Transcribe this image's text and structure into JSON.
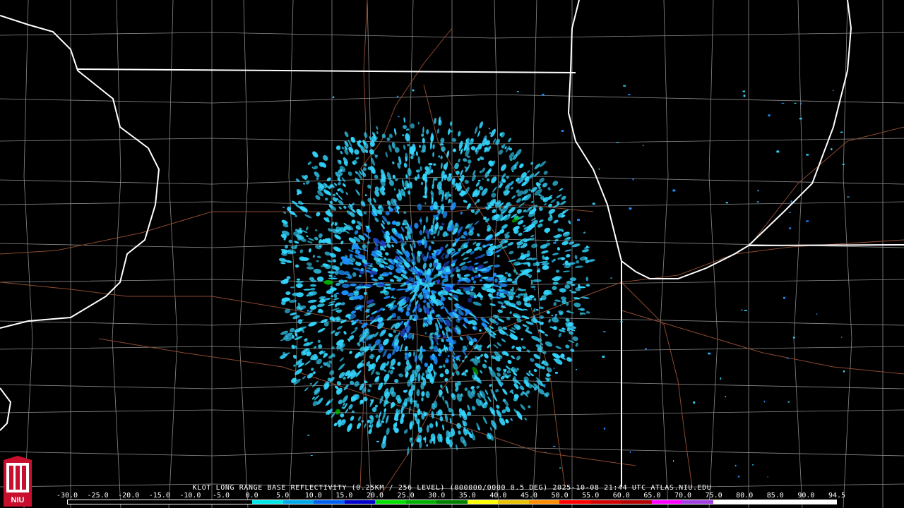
{
  "caption": "KLOT LONG RANGE BASE REFLECTIVITY (0.25KM / 256 LEVEL) (000000/0000 0.5 DEG) 2025-10-08 21:44 UTC  ATLAS.NIU.EDU",
  "logo": {
    "text": "NIU",
    "colors": {
      "background": "#c8102e",
      "seal": "#ffffff"
    }
  },
  "scale": {
    "labels": [
      "-30.0",
      "-25.0",
      "-20.0",
      "-15.0",
      "-10.0",
      "-5.0",
      "0.0",
      "5.0",
      "10.0",
      "15.0",
      "20.0",
      "25.0",
      "30.0",
      "35.0",
      "40.0",
      "45.0",
      "50.0",
      "55.0",
      "60.0",
      "65.0",
      "70.0",
      "75.0",
      "80.0",
      "85.0",
      "90.0",
      "94.5"
    ],
    "colors": [
      "#000000",
      "#000000",
      "#000000",
      "#000000",
      "#000000",
      "#000000",
      "#00e5e5",
      "#00a8e8",
      "#0060f0",
      "#0000c8",
      "#00e000",
      "#00b000",
      "#008000",
      "#ffff00",
      "#e8c000",
      "#ff8c00",
      "#ff0000",
      "#d00000",
      "#b00000",
      "#ff00ff",
      "#a040e0",
      "#ffffff",
      "#ffffff",
      "#ffffff",
      "#ffffff"
    ]
  },
  "map": {
    "colors": {
      "background": "#000000",
      "state_lines": "#ffffff",
      "county_lines": "#8a8a8a",
      "roads": "#8b4a2f",
      "echo_light": "#33d6ff",
      "echo_mid": "#1e90ff",
      "echo_deep": "#1f3fbf",
      "echo_green": "#00c800"
    }
  }
}
